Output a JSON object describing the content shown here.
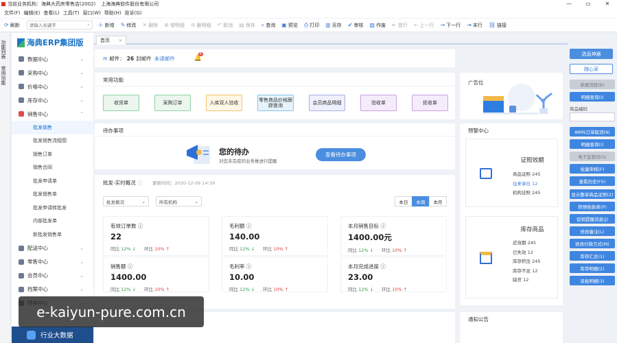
{
  "title_bar": {
    "text1": "当前业务机构：海典大药房零售店(2002)",
    "text2": "上海海典软件股份有限公司"
  },
  "window_controls": {
    "minimize": "—",
    "restore": "▭",
    "close": "✕"
  },
  "menus": [
    "文件(F)",
    "编辑(E)",
    "查看(L)",
    "工具(T)",
    "窗口(W)",
    "帮助(H)",
    "投诉(G)"
  ],
  "toolbar": {
    "refresh": "刷新",
    "search_placeholder": "请输入关键字",
    "buttons": [
      {
        "label": "新增",
        "icon": "＋",
        "enabled": true
      },
      {
        "label": "修改",
        "icon": "✎",
        "enabled": true
      },
      {
        "label": "删除",
        "icon": "✕",
        "enabled": false
      },
      {
        "label": "增明细",
        "icon": "⊕",
        "enabled": false
      },
      {
        "label": "删明细",
        "icon": "⊖",
        "enabled": false
      },
      {
        "label": "取消",
        "icon": "↶",
        "enabled": false
      },
      {
        "label": "保存",
        "icon": "▤",
        "enabled": false
      },
      {
        "label": "查询",
        "icon": "⌕",
        "enabled": true
      },
      {
        "label": "预览",
        "icon": "▣",
        "enabled": true
      },
      {
        "label": "打印",
        "icon": "⎙",
        "enabled": true
      },
      {
        "label": "另存",
        "icon": "▥",
        "enabled": true
      },
      {
        "label": "审核",
        "icon": "✔",
        "enabled": true
      },
      {
        "label": "作废",
        "icon": "▧",
        "enabled": true
      },
      {
        "label": "首行",
        "icon": "⇤",
        "enabled": false
      },
      {
        "label": "上一行",
        "icon": "←",
        "enabled": false
      },
      {
        "label": "下一行",
        "icon": "→",
        "enabled": true
      },
      {
        "label": "末行",
        "icon": "⇥",
        "enabled": true
      },
      {
        "label": "链接",
        "icon": "⛓",
        "enabled": true
      }
    ]
  },
  "vertical_tabs": [
    "功能列表",
    "常用功能"
  ],
  "sidebar": {
    "brand": "海典ERP集团版",
    "items": [
      "数据中心",
      "采购中心",
      "价格中心",
      "库存中心",
      "销售中心"
    ],
    "sub_items": [
      "批发销售",
      "批发销售流程图",
      "销售订单",
      "销售合同",
      "批发申请单",
      "批发销售单",
      "批发申请转批发",
      "内部批发单",
      "新批发销售单"
    ],
    "items_after": [
      "配送中心",
      "零售中心",
      "会员中心",
      "档案中心",
      "财务中心"
    ],
    "bottom": "行业大数据"
  },
  "tabs": [
    {
      "label": "首页",
      "close": "✕"
    }
  ],
  "mail": {
    "label": "邮件：",
    "count": "26",
    "unit": "封邮件",
    "unread": "未读邮件",
    "badge": "8"
  },
  "common_functions": {
    "title": "常用功能",
    "buttons": [
      {
        "label": "收货单",
        "bg": "#eaf6ee",
        "border": "#8fd0a4"
      },
      {
        "label": "采购订单",
        "bg": "#eaf6ee",
        "border": "#8fd0a4"
      },
      {
        "label": "入库双人验收",
        "bg": "#fff7e6",
        "border": "#f2c46d"
      },
      {
        "label": "零售商品价格跟踪查询",
        "bg": "#e6f3fb",
        "border": "#83c3e8"
      },
      {
        "label": "会员商品明细",
        "bg": "#eef0fb",
        "border": "#a7b1e5"
      },
      {
        "label": "验收单",
        "bg": "#f5ecfb",
        "border": "#c9a1e4"
      },
      {
        "label": "拒收单",
        "bg": "#f5ecfb",
        "border": "#c9a1e4"
      }
    ]
  },
  "todo": {
    "title": "待办事项",
    "heading": "您的待办",
    "sub": "对您未完成的业务推进行提醒",
    "button": "查看待办事项"
  },
  "realtime": {
    "title": "批发-实时概况",
    "updated": "更新时间：2020-12-09 14:39",
    "select1": "批发概况",
    "select2": "所有机构",
    "periods": [
      "本日",
      "本周",
      "本月"
    ],
    "active_period": "本周",
    "stats": [
      {
        "label": "有效订单数",
        "value": "22",
        "yoy": "12%",
        "yoy_dir": "down",
        "mom": "10%",
        "mom_dir": "up"
      },
      {
        "label": "毛利额",
        "value": "140.00",
        "yoy": "12%",
        "yoy_dir": "down",
        "mom": "10%",
        "mom_dir": "up"
      },
      {
        "label": "本月销售目标",
        "value": "1400.00元",
        "yoy": "12%",
        "yoy_dir": "down",
        "mom": "10%",
        "mom_dir": "up"
      },
      {
        "label": "销售额",
        "value": "1400.00",
        "yoy": "12%",
        "yoy_dir": "down",
        "mom": "10%",
        "mom_dir": "up"
      },
      {
        "label": "毛利率",
        "value": "10.00",
        "yoy": "12%",
        "yoy_dir": "down",
        "mom": "10%",
        "mom_dir": "up"
      },
      {
        "label": "本月完成进度",
        "value": "23.00",
        "yoy": "12%",
        "yoy_dir": "down",
        "mom": "10%",
        "mom_dir": "up"
      }
    ],
    "yoy_label": "同比",
    "mom_label": "环比"
  },
  "ad": {
    "title": "广告位"
  },
  "warning": {
    "title": "预警中心",
    "cert": {
      "title": "证照效期",
      "lines": [
        "商品证照 245",
        "往来单位 12",
        "机构证照 245"
      ]
    },
    "stock": {
      "title": "库存商品",
      "lines": [
        "近效期 245",
        "已失效 12",
        "库存积压 245",
        "库存不足 12",
        "缺货 12"
      ]
    }
  },
  "notice": {
    "title": "通知公告"
  },
  "right_panel": {
    "big_buttons": [
      "选品神器",
      "随心采"
    ],
    "top_buttons": [
      {
        "label": "单据流程(B)",
        "enabled": false
      },
      {
        "label": "明细查询(I)",
        "enabled": true
      }
    ],
    "code_label": "商品编码",
    "buttons": [
      {
        "label": "WMS订单取消(9)",
        "enabled": true
      },
      {
        "label": "明细查询(I)",
        "enabled": true
      },
      {
        "label": "电子监管码(S)",
        "enabled": false
      },
      {
        "label": "批量审核(F)",
        "enabled": true
      },
      {
        "label": "查看历史(F5)",
        "enabled": true
      },
      {
        "label": "显示整单商品证照(2)",
        "enabled": true
      },
      {
        "label": "转预收款单(P)",
        "enabled": true
      },
      {
        "label": "促销提醒消息(J)",
        "enabled": true
      },
      {
        "label": "修改备注(L)",
        "enabled": true
      },
      {
        "label": "修改付款方式(M)",
        "enabled": true
      },
      {
        "label": "库存汇总(1)",
        "enabled": true
      },
      {
        "label": "库存明细(2)",
        "enabled": true
      },
      {
        "label": "该批明细(3)",
        "enabled": true
      }
    ]
  },
  "watermark": "e-kaiyun-pure.com.cn"
}
